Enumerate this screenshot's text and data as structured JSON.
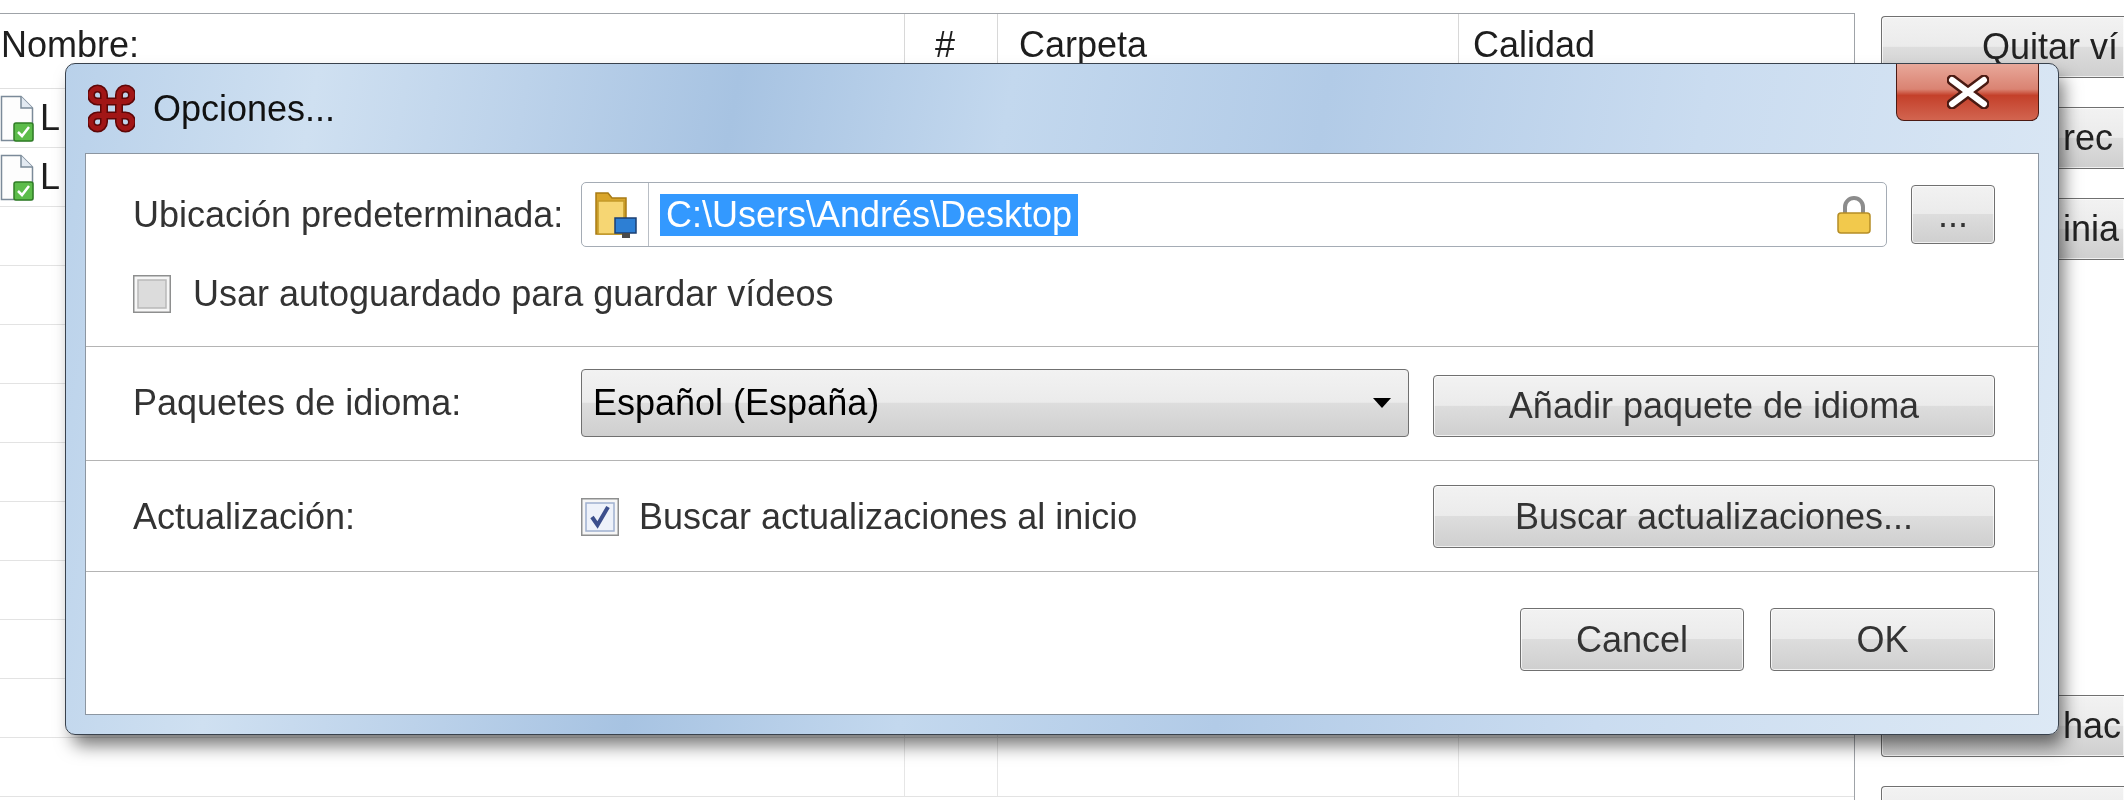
{
  "list": {
    "columns": [
      {
        "label": "Nombre:"
      },
      {
        "label": "#"
      },
      {
        "label": "Carpeta"
      },
      {
        "label": "Calidad"
      }
    ],
    "rows": [
      {
        "name": "L"
      },
      {
        "name": "L"
      }
    ]
  },
  "side_buttons": [
    {
      "label": "Quitar ví"
    },
    {
      "label": "rec"
    },
    {
      "label": "inia"
    },
    {
      "label": "hac"
    }
  ],
  "dialog": {
    "title": "Opciones...",
    "default_location": {
      "label": "Ubicación predeterminada:",
      "value": "C:\\Users\\Andrés\\Desktop",
      "value_selected": true,
      "browse_button": "..."
    },
    "autosave": {
      "label": "Usar autoguardado para guardar vídeos",
      "checked": false
    },
    "language": {
      "label": "Paquetes de idioma:",
      "value": "Español (España)",
      "button": "Añadir paquete de idioma"
    },
    "updates": {
      "label": "Actualización:",
      "check_label": "Buscar actualizaciones al inicio",
      "checked": true,
      "button": "Buscar actualizaciones..."
    },
    "buttons": [
      "Cancel",
      "OK"
    ]
  }
}
